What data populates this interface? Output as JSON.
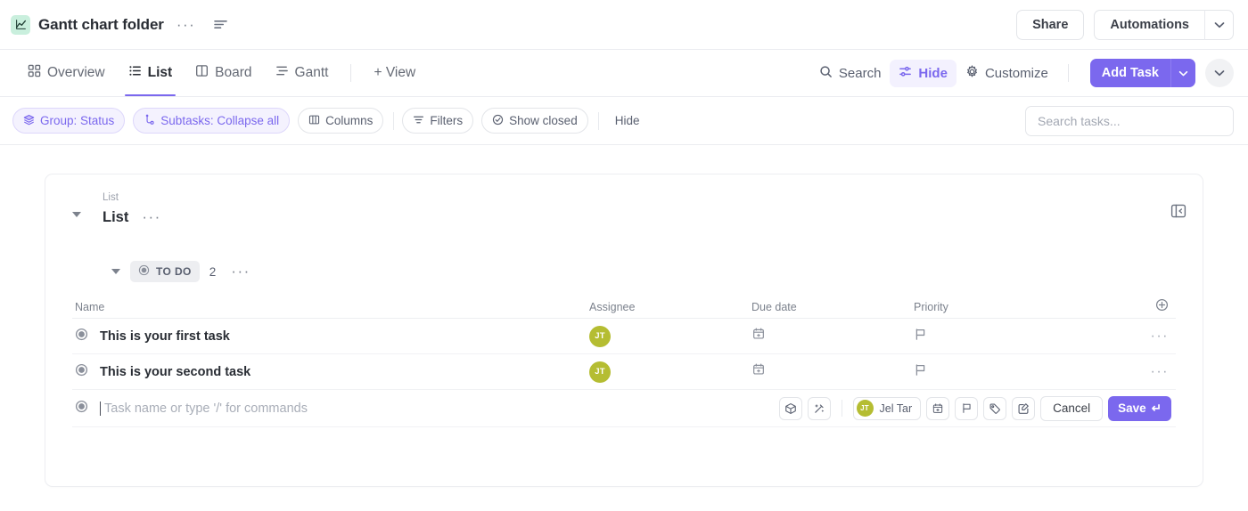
{
  "topbar": {
    "folder_icon": "chart-folder-icon",
    "title": "Gantt chart folder",
    "more_label": "···",
    "lines_icon": "list-lines-icon",
    "share_label": "Share",
    "automations_label": "Automations",
    "automations_caret": "chevron-down-icon"
  },
  "viewbar": {
    "tabs": [
      {
        "label": "Overview",
        "icon": "grid-icon",
        "active": false
      },
      {
        "label": "List",
        "icon": "list-icon",
        "active": true
      },
      {
        "label": "Board",
        "icon": "board-icon",
        "active": false
      },
      {
        "label": "Gantt",
        "icon": "gantt-icon",
        "active": false
      }
    ],
    "add_view_label": "+ View",
    "search_label": "Search",
    "hide_label": "Hide",
    "customize_label": "Customize",
    "add_task_label": "Add Task",
    "add_task_caret": "chevron-down-icon",
    "overflow_caret": "chevron-down-icon"
  },
  "filterbar": {
    "chips": [
      {
        "label": "Group: Status",
        "icon": "layers-icon",
        "highlight": true
      },
      {
        "label": "Subtasks: Collapse all",
        "icon": "subtask-icon",
        "highlight": true
      },
      {
        "label": "Columns",
        "icon": "columns-icon",
        "highlight": false
      },
      {
        "label": "Filters",
        "icon": "filter-icon",
        "highlight": false
      },
      {
        "label": "Show closed",
        "icon": "check-circle-icon",
        "highlight": false
      }
    ],
    "hide_label": "Hide",
    "search_placeholder": "Search tasks..."
  },
  "list": {
    "breadcrumb": "List",
    "title": "List",
    "more_label": "···",
    "collapse_icon": "panel-collapse-icon"
  },
  "group": {
    "status_label": "TO DO",
    "count": "2",
    "more_label": "···"
  },
  "table": {
    "columns": [
      "Name",
      "Assignee",
      "Due date",
      "Priority"
    ],
    "add_column_icon": "plus-circle-icon",
    "rows": [
      {
        "name": "This is your first task",
        "assignee_initials": "JT",
        "due_date_icon": "calendar-plus-icon",
        "priority_icon": "flag-icon",
        "row_menu": "···"
      },
      {
        "name": "This is your second task",
        "assignee_initials": "JT",
        "due_date_icon": "calendar-plus-icon",
        "priority_icon": "flag-icon",
        "row_menu": "···"
      }
    ]
  },
  "new_task": {
    "placeholder": "Task name or type '/' for commands",
    "icons": [
      "cube-icon",
      "magic-wand-icon"
    ],
    "assignee_initials": "JT",
    "assignee_name": "Jel Tar",
    "trailing_icons": [
      "calendar-plus-icon",
      "flag-icon",
      "tag-icon",
      "edit-square-icon"
    ],
    "cancel_label": "Cancel",
    "save_label": "Save",
    "save_key_glyph": "↵"
  },
  "colors": {
    "accent": "#7b68ee",
    "accent_soft": "#f3f1fe",
    "avatar": "#b5bd32",
    "folder_icon_bg": "#c9efdd",
    "border": "#e3e5e9",
    "text": "#292d34",
    "muted": "#7c828d"
  }
}
